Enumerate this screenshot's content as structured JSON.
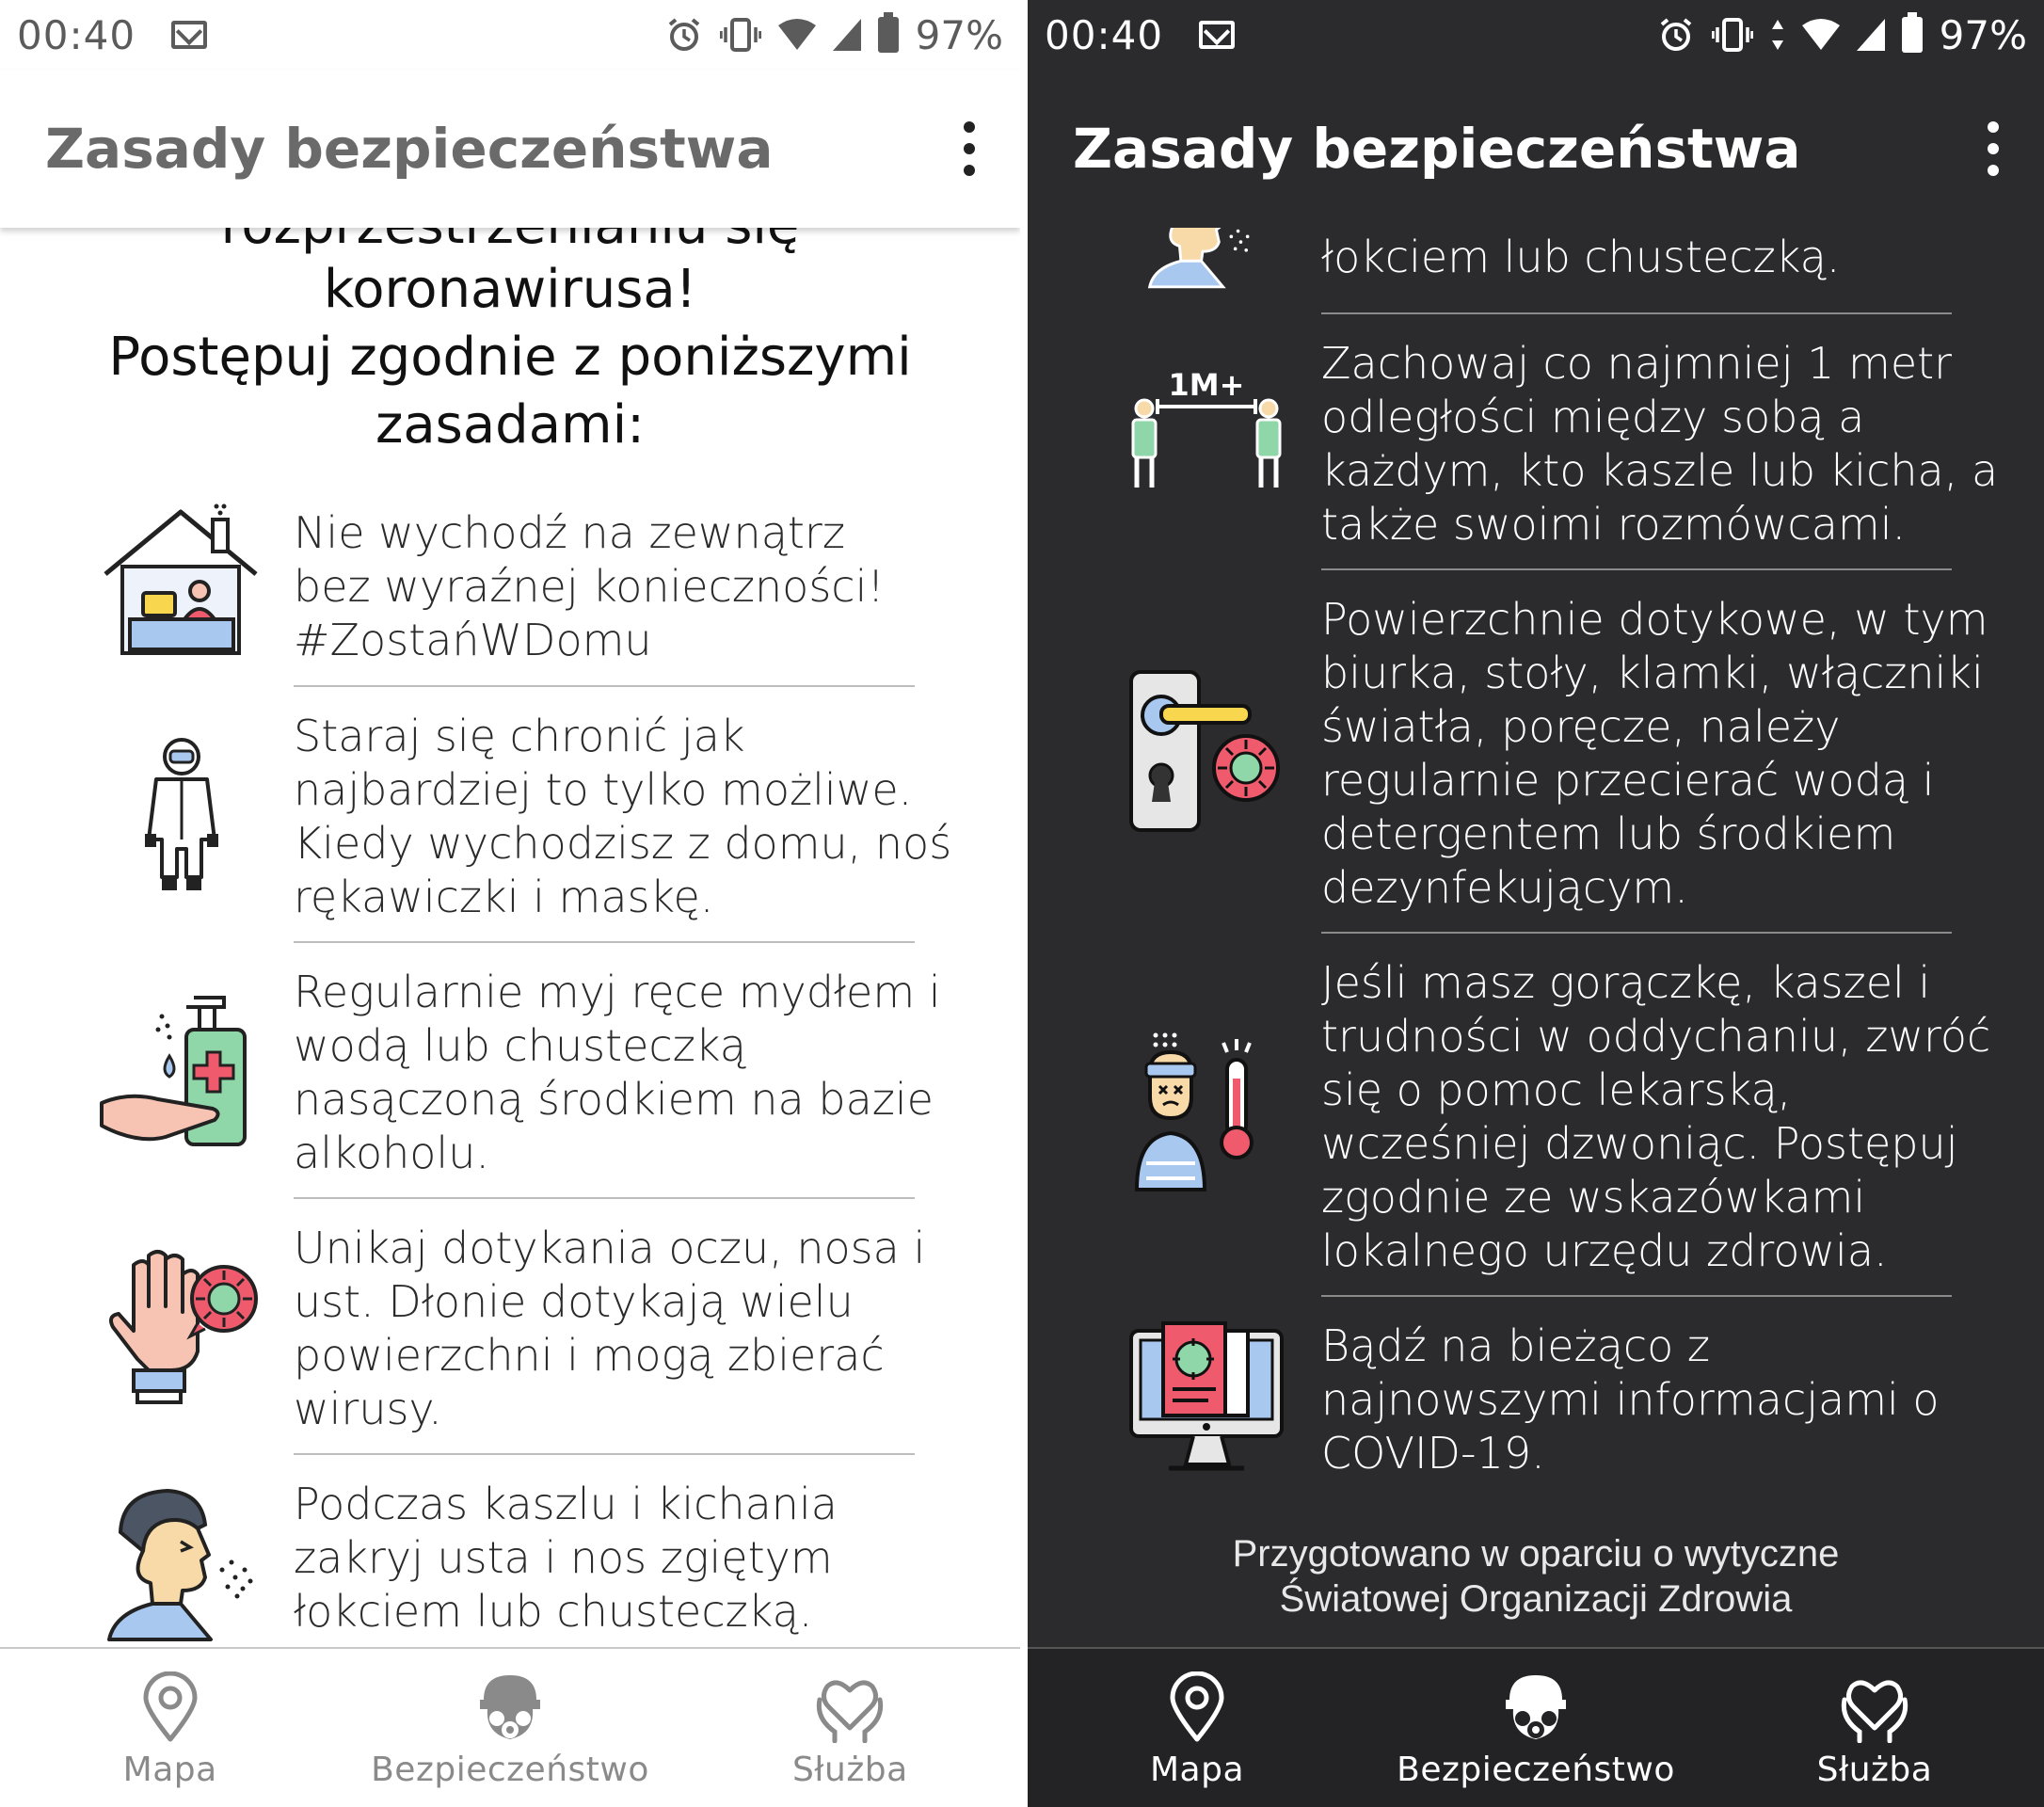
{
  "status": {
    "time": "00:40",
    "battery": "97%"
  },
  "toolbar": {
    "title": "Zasady bezpieczeństwa"
  },
  "light": {
    "intro_lines": [
      "rozprzestrzenianiu się",
      "koronawirusa!",
      "Postępuj zgodnie z poniższymi",
      "zasadami:"
    ],
    "rules": [
      {
        "icon": "house-stay-home-icon",
        "text": "Nie wychodź na zewnątrz bez wyraźnej konieczności! #ZostańWDomu"
      },
      {
        "icon": "protective-suit-icon",
        "text": "Staraj się chronić jak najbardziej to tylko możliwe. Kiedy wychodzisz z domu, noś rękawiczki i maskę."
      },
      {
        "icon": "hand-sanitizer-icon",
        "text": "Regularnie myj ręce mydłem i wodą lub chusteczką nasączoną środkiem na bazie alkoholu."
      },
      {
        "icon": "hand-virus-icon",
        "text": "Unikaj dotykania oczu, nosa i ust. Dłonie dotykają wielu powierzchni i mogą zbierać wirusy."
      },
      {
        "icon": "sneezing-person-icon",
        "text": "Podczas kaszlu i kichania zakryj usta i nos zgiętym łokciem lub chusteczką."
      }
    ]
  },
  "dark": {
    "rules": [
      {
        "icon": "sneezing-person-icon",
        "text": "zakryj usta i nos zgiętym łokciem lub chusteczką."
      },
      {
        "icon": "social-distance-icon",
        "text": "Zachowaj co najmniej 1 metr odległości między sobą a każdym, kto kaszle lub kicha, a także swoimi rozmówcami."
      },
      {
        "icon": "door-handle-virus-icon",
        "text": "Powierzchnie dotykowe, w tym biurka, stoły, klamki, włączniki światła, poręcze, należy regularnie przecierać wodą i detergentem lub środkiem dezynfekującym."
      },
      {
        "icon": "fever-thermometer-icon",
        "text": "Jeśli masz gorączkę, kaszel i trudności w oddychaniu, zwróć się o pomoc lekarską, wcześniej dzwoniąc. Postępuj zgodnie ze wskazówkami lokalnego urzędu zdrowia."
      },
      {
        "icon": "monitor-news-icon",
        "text": "Bądź na bieżąco z najnowszymi informacjami o COVID-19."
      }
    ],
    "distance_label": "1M+",
    "footer_lines": [
      "Przygotowano w oparciu o wytyczne",
      "Światowej Organizacji Zdrowia"
    ]
  },
  "nav": {
    "items": [
      {
        "label": "Mapa",
        "icon": "map-pin-icon"
      },
      {
        "label": "Bezpieczeństwo",
        "icon": "gas-mask-icon"
      },
      {
        "label": "Służba",
        "icon": "heart-hands-icon"
      }
    ]
  },
  "colors": {
    "dark_bg": "#2b2b2d",
    "accent_red": "#ef5b6c",
    "accent_green": "#8fd6a9",
    "accent_blue": "#a9c8f0",
    "accent_yellow": "#f8d64e"
  }
}
